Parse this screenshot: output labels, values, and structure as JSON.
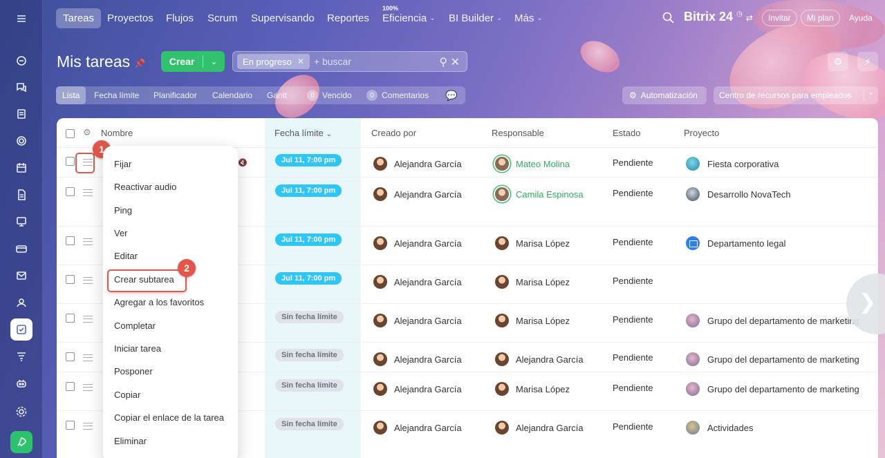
{
  "nav": {
    "tabs": [
      "Tareas",
      "Proyectos",
      "Flujos",
      "Scrum",
      "Supervisando",
      "Reportes",
      "Eficiencia",
      "BI Builder",
      "Más"
    ],
    "efficiency_badge": "100%",
    "brand": "Bitrix 24",
    "invite": "Invitar",
    "plan": "Mi plan",
    "help": "Ayuda"
  },
  "header": {
    "title": "Mis tareas",
    "create_label": "Crear",
    "filter_chip": "En progreso",
    "search_placeholder": "+ buscar"
  },
  "views": {
    "list": "Lista",
    "deadline": "Fecha límite",
    "planner": "Planificador",
    "calendar": "Calendario",
    "gantt": "Gantt",
    "overdue_count": "0",
    "overdue": "Vencido",
    "comments_count": "0",
    "comments": "Comentarios",
    "automation": "Automatización",
    "resources": "Centro de recursos para empleados"
  },
  "table": {
    "columns": [
      "Nombre",
      "Fecha límite",
      "Creado por",
      "Responsable",
      "Estado",
      "Proyecto"
    ],
    "rows": [
      {
        "deadline": "Jul 11, 7:00 pm",
        "creator": "Alejandra García",
        "responsible": "Mateo Molina",
        "status": "Pendiente",
        "project": "Fiesta corporativa"
      },
      {
        "deadline": "Jul 11, 7:00 pm",
        "creator": "Alejandra García",
        "responsible": "Camila Espinosa",
        "status": "Pendiente",
        "project": "Desarrollo NovaTech"
      },
      {
        "deadline": "Jul 11, 7:00 pm",
        "creator": "Alejandra García",
        "responsible": "Marisa López",
        "status": "Pendiente",
        "project": "Departamento legal"
      },
      {
        "deadline": "Jul 11, 7:00 pm",
        "creator": "Alejandra García",
        "responsible": "Marisa López",
        "status": "Pendiente",
        "project": ""
      },
      {
        "deadline": "Sin fecha límite",
        "creator": "Alejandra García",
        "responsible": "Marisa López",
        "status": "Pendiente",
        "project": "Grupo del departamento de marketing"
      },
      {
        "deadline": "Sin fecha límite",
        "creator": "Alejandra García",
        "responsible": "Alejandra García",
        "status": "Pendiente",
        "project": "Grupo del departamento de marketing"
      },
      {
        "deadline": "Sin fecha límite",
        "creator": "Alejandra García",
        "responsible": "Marisa López",
        "status": "Pendiente",
        "project": "Grupo del departamento de marketing"
      },
      {
        "deadline": "Sin fecha límite",
        "creator": "Alejandra García",
        "responsible": "Alejandra García",
        "status": "Pendiente",
        "project": "Actividades"
      }
    ]
  },
  "context_menu": {
    "items": [
      "Fijar",
      "Reactivar audio",
      "Ping",
      "Ver",
      "Editar",
      "Crear subtarea",
      "Agregar a los favoritos",
      "Completar",
      "Iniciar tarea",
      "Posponer",
      "Copiar",
      "Copiar el enlace de la tarea",
      "Eliminar"
    ]
  },
  "callouts": [
    "1",
    "2"
  ],
  "colors": {
    "accent_green": "#32c16c",
    "deadline_blue": "#2fc6f6",
    "callout_red": "#e2574c"
  }
}
